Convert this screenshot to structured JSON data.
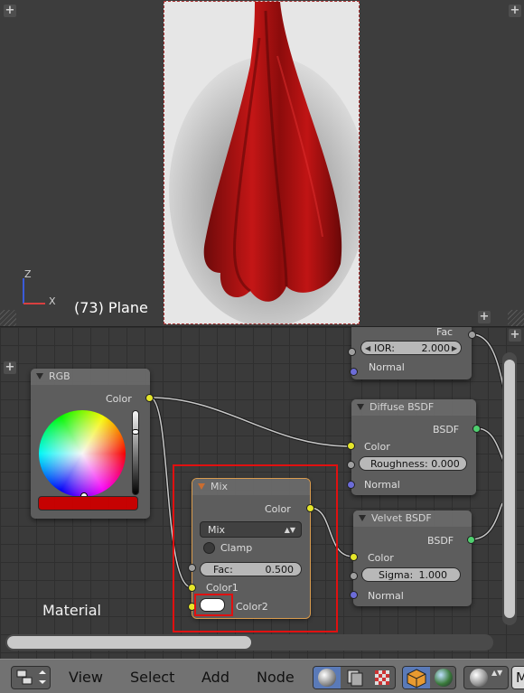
{
  "viewport": {
    "object_label": "(73) Plane",
    "axis_z": "Z",
    "axis_x": "X",
    "plus_icon": "+"
  },
  "nodes": {
    "rgb": {
      "title": "RGB",
      "output": "Color",
      "swatch_color": "#cc0000"
    },
    "glass_partial": {
      "output": "Fac",
      "ior_label": "IOR:",
      "ior_value": "2.000",
      "normal": "Normal"
    },
    "diffuse": {
      "title": "Diffuse BSDF",
      "output": "BSDF",
      "color": "Color",
      "roughness_label": "Roughness: 0.000",
      "normal": "Normal"
    },
    "velvet": {
      "title": "Velvet BSDF",
      "output": "BSDF",
      "color": "Color",
      "sigma_label": "Sigma:",
      "sigma_value": "1.000",
      "normal": "Normal"
    },
    "mix": {
      "title": "Mix",
      "output": "Color",
      "blend_mode": "Mix",
      "clamp_label": "Clamp",
      "fac_label": "Fac:",
      "fac_value": "0.500",
      "color1": "Color1",
      "color2": "Color2",
      "color2_value": "#ffffff"
    }
  },
  "editor": {
    "material_label": "Material"
  },
  "header": {
    "menus": [
      "View",
      "Select",
      "Add",
      "Node"
    ],
    "trailing": "M"
  },
  "colors": {
    "accent_highlight": "#e01010",
    "socket_yellow": "#e5e62a",
    "socket_green": "#4fd06f"
  }
}
